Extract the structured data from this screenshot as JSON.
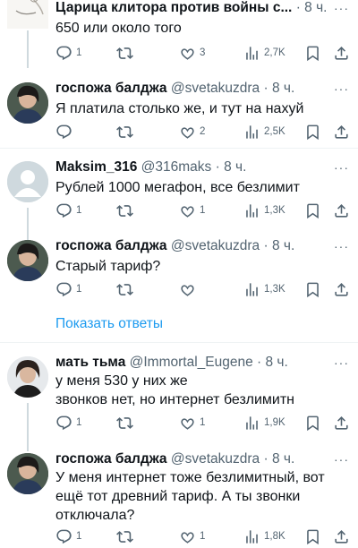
{
  "tweets": [
    {
      "name": "Царица клитора против войны с...",
      "handle": "",
      "time": "· 8 ч.",
      "lines": [
        "650 или около того"
      ],
      "replies": "1",
      "retweets": "",
      "likes": "3",
      "views": "2,7K"
    },
    {
      "name": "госпожа балджа",
      "handle": "@svetakuzdra",
      "time": "· 8 ч.",
      "lines": [
        "Я платила столько же, и тут на нахуй"
      ],
      "replies": "",
      "retweets": "",
      "likes": "2",
      "views": "2,5K"
    },
    {
      "name": "Maksim_316",
      "handle": "@316maks",
      "time": "· 8 ч.",
      "lines": [
        "Рублей 1000 мегафон, все безлимит"
      ],
      "replies": "1",
      "retweets": "",
      "likes": "1",
      "views": "1,3K"
    },
    {
      "name": "госпожа балджа",
      "handle": "@svetakuzdra",
      "time": "· 8 ч.",
      "lines": [
        "Старый тариф?"
      ],
      "replies": "1",
      "retweets": "",
      "likes": "",
      "views": "1,3K"
    },
    {
      "name": "мать тьма",
      "handle": "@Immortal_Eugene",
      "time": "· 8 ч.",
      "lines": [
        "у меня 530 у них же",
        "звонков нет, но интернет безлимитн"
      ],
      "replies": "1",
      "retweets": "",
      "likes": "1",
      "views": "1,9K"
    },
    {
      "name": "госпожа балджа",
      "handle": "@svetakuzdra",
      "time": "· 8 ч.",
      "lines": [
        "У меня интернет тоже безлимитный, вот",
        "ещё тот древний тариф. А ты звонки",
        "отключала?"
      ],
      "replies": "1",
      "retweets": "",
      "likes": "1",
      "views": "1,8K"
    }
  ],
  "show_replies": "Показать ответы",
  "colors": {
    "text": "#0f1419",
    "secondary": "#536471",
    "link": "#1d9bf0",
    "separator": "#eff3f4"
  },
  "icons": [
    "reply-icon",
    "retweet-icon",
    "like-icon",
    "views-icon",
    "bookmark-icon",
    "share-icon",
    "more-icon"
  ]
}
